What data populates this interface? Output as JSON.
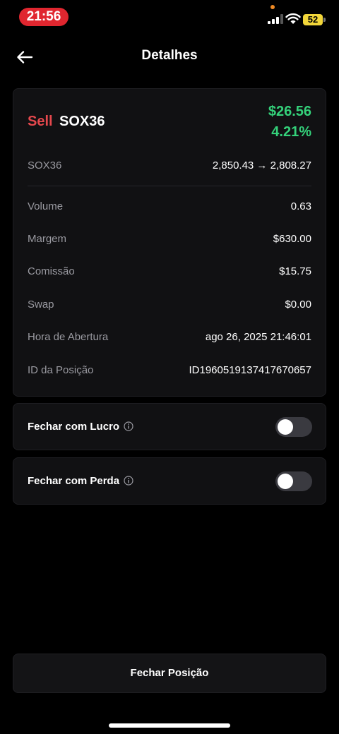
{
  "status_bar": {
    "time": "21:56",
    "battery": "52",
    "icons": [
      "signal-icon",
      "wifi-icon",
      "battery-icon"
    ],
    "time_pill_color": "#e0262f"
  },
  "header": {
    "title": "Detalhes",
    "back_icon": "arrow-left-icon"
  },
  "position": {
    "side": "Sell",
    "symbol": "SOX36",
    "pnl": "$26.56",
    "pnl_percent": "4.21%",
    "price_label": "SOX36",
    "price_change": "2,850.43 → 2,808.27",
    "side_color": "#e5484d",
    "profit_color": "#34d17a"
  },
  "details": [
    {
      "label": "Volume",
      "value": "0.63"
    },
    {
      "label": "Margem",
      "value": "$630.00"
    },
    {
      "label": "Comissão",
      "value": "$15.75"
    },
    {
      "label": "Swap",
      "value": "$0.00"
    },
    {
      "label": "Hora de Abertura",
      "value": "ago 26, 2025 21:46:01"
    },
    {
      "label": "ID da Posição",
      "value": "ID1960519137417670657"
    }
  ],
  "toggles": [
    {
      "label": "Fechar com Lucro",
      "on": false,
      "icon": "info-icon"
    },
    {
      "label": "Fechar com Perda",
      "on": false,
      "icon": "info-icon"
    }
  ],
  "actions": {
    "close_label": "Fechar Posição"
  }
}
